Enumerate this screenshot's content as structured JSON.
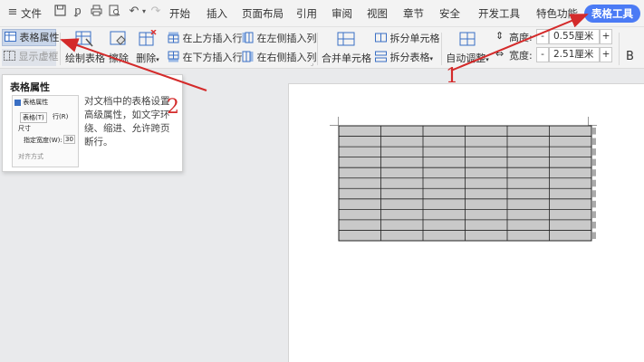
{
  "menubar": {
    "file_menu": "文件",
    "tabs": [
      "开始",
      "插入",
      "页面布局",
      "引用",
      "审阅",
      "视图",
      "章节",
      "安全",
      "开发工具",
      "特色功能",
      "表格工具"
    ]
  },
  "ribbon": {
    "table_properties": "表格属性",
    "show_gridlines": "显示虚框",
    "draw_table": "绘制表格",
    "eraser": "擦除",
    "delete": "删除",
    "insert_above": "在上方插入行",
    "insert_below": "在下方插入行",
    "insert_left": "在左侧插入列",
    "insert_right": "在右侧插入列",
    "merge_cells": "合并单元格",
    "split_cells": "拆分单元格",
    "split_table": "拆分表格",
    "auto_fit": "自动调整",
    "height_label": "高度:",
    "height_value": "0.55厘米",
    "width_label": "宽度:",
    "width_value": "2.51厘米",
    "bold": "B"
  },
  "tooltip": {
    "title": "表格属性",
    "description": "对文档中的表格设置高级属性，如文字环绕、缩进、允许跨页断行。",
    "thumb_title": "表格属性",
    "thumb_tab1": "表格(T)",
    "thumb_tab2": "行(R)",
    "thumb_size": "尺寸",
    "thumb_width_label": "指定宽度(W):",
    "thumb_width_value": "30",
    "thumb_align": "对齐方式"
  },
  "document": {
    "table_rows": 11,
    "table_cols": 6,
    "cell_fill": "#c9c9c9"
  },
  "annotations": {
    "label1": "1",
    "label2": "2",
    "arrow_color": "#d42a2a"
  },
  "colors": {
    "accent": "#4b7bf5"
  }
}
